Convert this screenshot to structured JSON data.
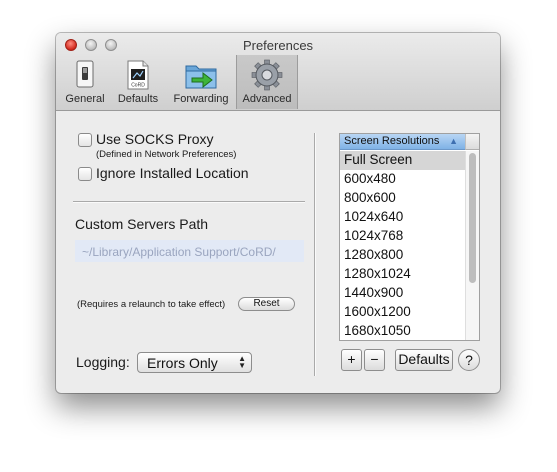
{
  "window": {
    "title": "Preferences"
  },
  "toolbar": {
    "items": [
      {
        "label": "General",
        "icon": "switch-icon"
      },
      {
        "label": "Defaults",
        "icon": "document-icon",
        "icon_text": "CoRD"
      },
      {
        "label": "Forwarding",
        "icon": "folder-arrow-icon"
      },
      {
        "label": "Advanced",
        "icon": "gear-icon",
        "selected": true
      }
    ]
  },
  "advanced": {
    "socks_label": "Use SOCKS Proxy",
    "socks_note": "(Defined in Network Preferences)",
    "socks_checked": false,
    "ignore_label": "Ignore Installed Location",
    "ignore_checked": false,
    "servers_path_title": "Custom Servers Path",
    "servers_path_placeholder": "~/Library/Application Support/CoRD/",
    "relaunch_note": "(Requires a relaunch to take effect)",
    "reset_label": "Reset",
    "logging_label": "Logging:",
    "logging_value": "Errors Only"
  },
  "resolutions": {
    "header": "Screen Resolutions",
    "sort": "ascending",
    "rows": [
      "Full Screen",
      "600x480",
      "800x600",
      "1024x640",
      "1024x768",
      "1280x800",
      "1280x1024",
      "1440x900",
      "1600x1200",
      "1680x1050"
    ],
    "add_label": "+",
    "remove_label": "−",
    "defaults_label": "Defaults",
    "help_label": "?"
  },
  "colors": {
    "accent_header": "#7fb2e6",
    "close_button": "#d1281c",
    "field_background": "#e2e9f6",
    "field_text": "#9aa5bf"
  }
}
